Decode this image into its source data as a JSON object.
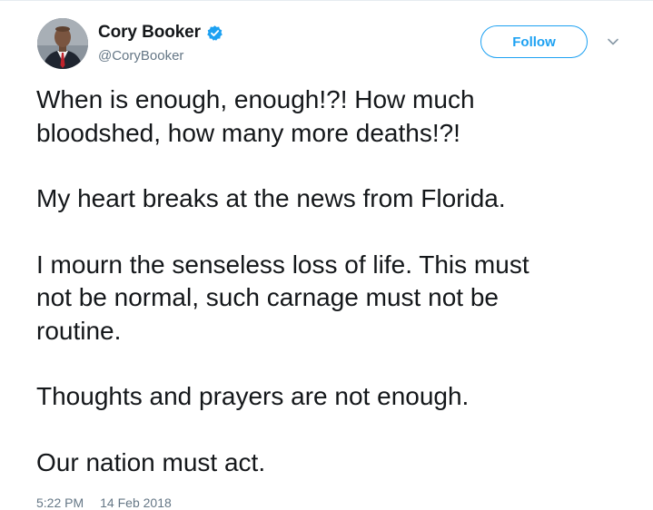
{
  "user": {
    "display_name": "Cory Booker",
    "handle": "@CoryBooker",
    "verified": true,
    "avatar_icon": "profile-photo"
  },
  "actions": {
    "follow_label": "Follow",
    "menu_icon": "chevron-down-icon"
  },
  "tweet": {
    "paragraphs": [
      "When is enough, enough!?! How much\nbloodshed, how many more deaths!?!",
      "My heart breaks at the news from Florida.",
      "I mourn the senseless loss of life. This must\nnot be normal, such carnage must not be\nroutine.",
      "Thoughts and prayers are not enough.",
      "Our nation must act."
    ],
    "time": "5:22 PM",
    "date": "14 Feb 2018"
  },
  "colors": {
    "accent": "#1da1f2",
    "text": "#14171a",
    "secondary_text": "#657786"
  }
}
